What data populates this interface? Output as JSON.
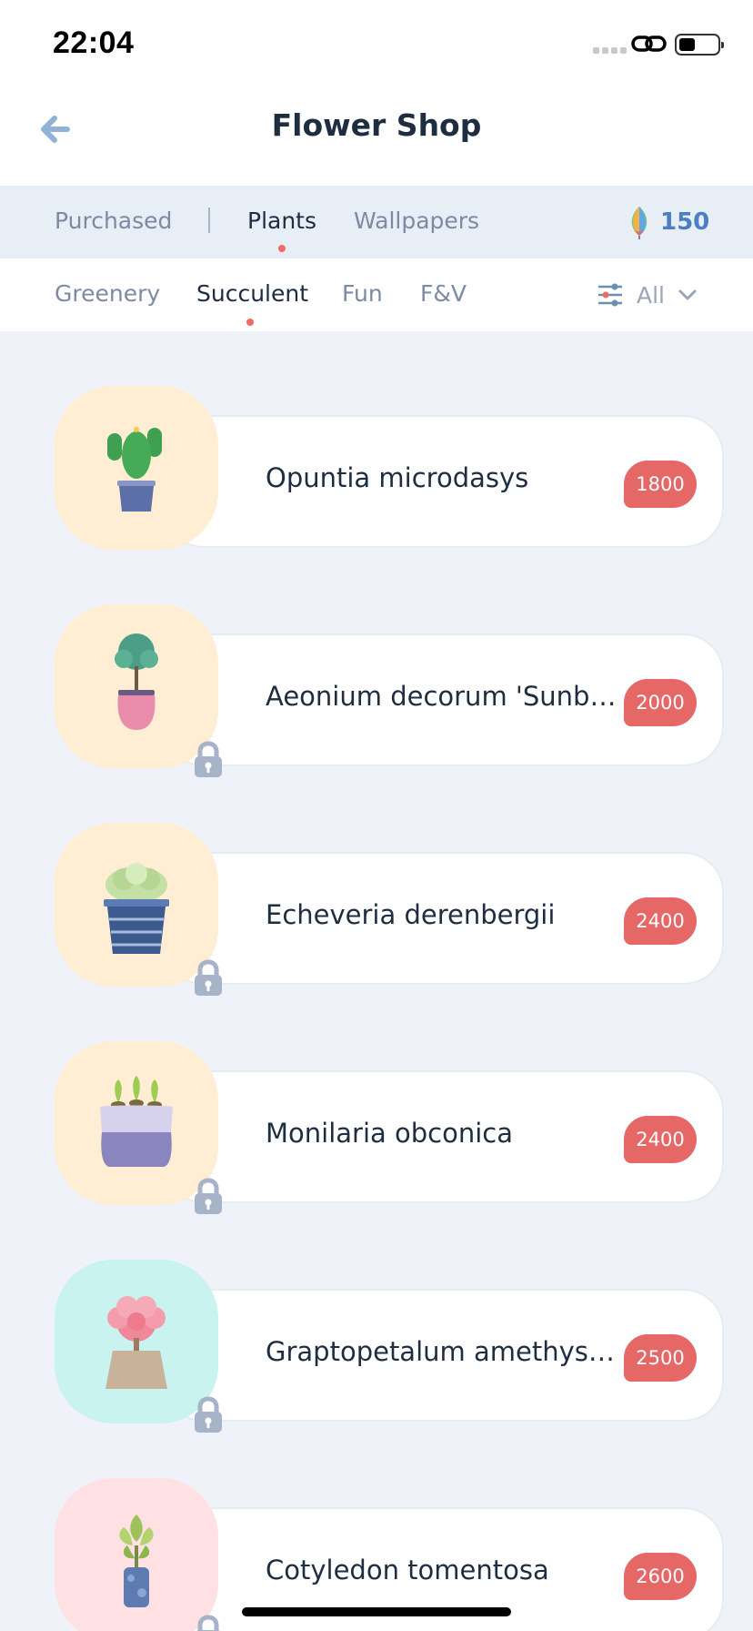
{
  "status_bar": {
    "time": "22:04"
  },
  "header": {
    "title": "Flower Shop",
    "back_icon": "arrow-left-icon"
  },
  "tabs": [
    {
      "label": "Purchased",
      "active": false
    },
    {
      "label": "Plants",
      "active": true
    },
    {
      "label": "Wallpapers",
      "active": false
    }
  ],
  "balance": {
    "value": "150",
    "icon": "leaf-coin-icon"
  },
  "subtabs": [
    {
      "label": "Greenery",
      "active": false
    },
    {
      "label": "Succulent",
      "active": true
    },
    {
      "label": "Fun",
      "active": false
    },
    {
      "label": "F&V",
      "active": false
    }
  ],
  "filter": {
    "label": "All",
    "icon": "sliders-icon"
  },
  "items": [
    {
      "name": "Opuntia microdasys",
      "price": "1800",
      "locked": false,
      "bg": "#ffeed3",
      "plant": "cactus"
    },
    {
      "name": "Aeonium decorum 'Sunburst'",
      "price": "2000",
      "locked": true,
      "bg": "#ffeed3",
      "plant": "tree"
    },
    {
      "name": "Echeveria derenbergii",
      "price": "2400",
      "locked": true,
      "bg": "#ffeed3",
      "plant": "rosette"
    },
    {
      "name": "Monilaria obconica",
      "price": "2400",
      "locked": true,
      "bg": "#ffeed3",
      "plant": "sprouts"
    },
    {
      "name": "Graptopetalum amethystinum",
      "price": "2500",
      "locked": true,
      "bg": "#c9f3ee",
      "plant": "pink-rosette"
    },
    {
      "name": "Cotyledon tomentosa",
      "price": "2600",
      "locked": true,
      "bg": "#ffe1e4",
      "plant": "bear-paw"
    }
  ],
  "colors": {
    "accent": "#e66866",
    "dot": "#ee6c64",
    "coin_text": "#4b7fc1"
  }
}
